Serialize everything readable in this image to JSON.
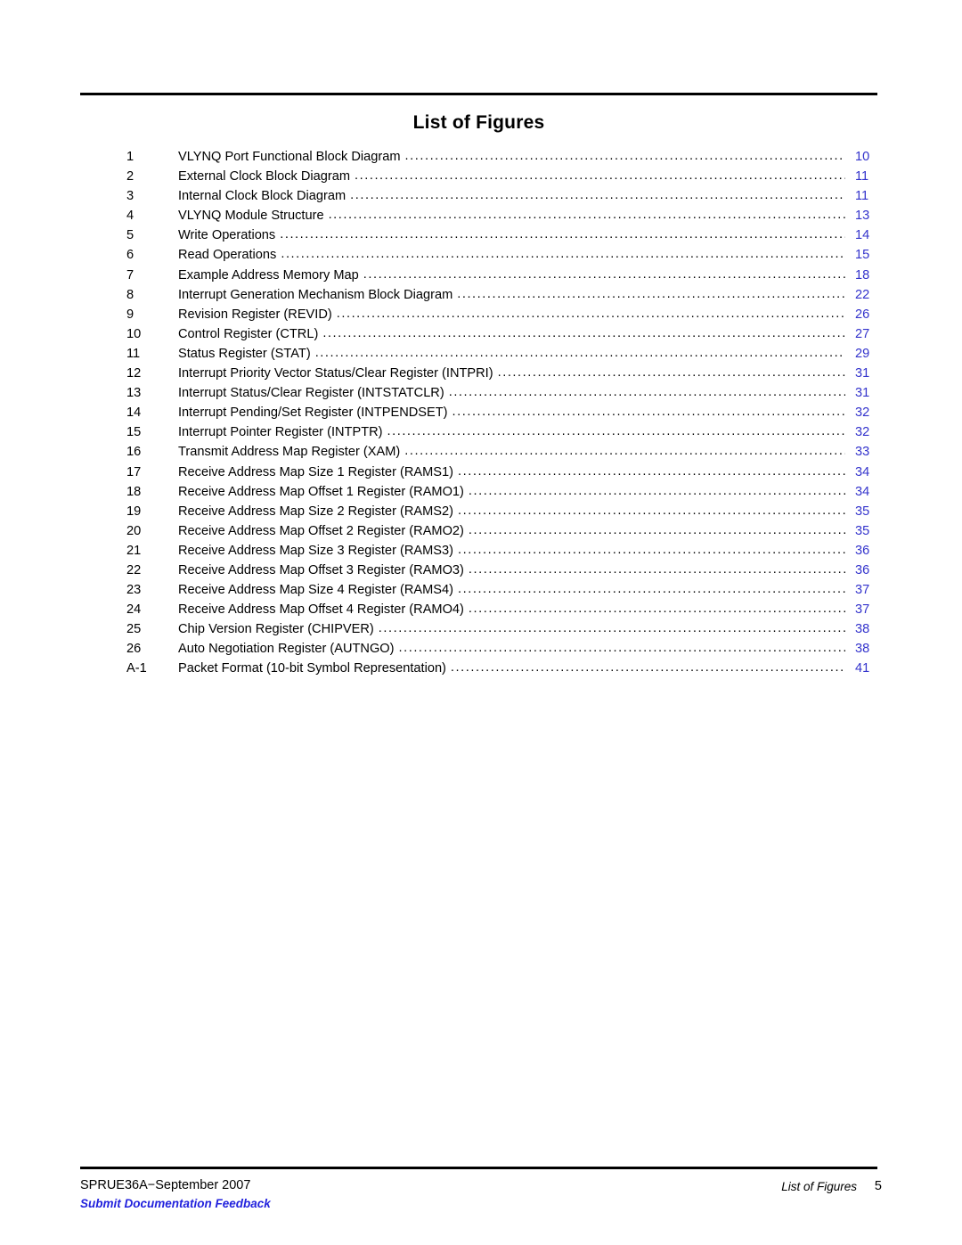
{
  "header": {
    "title": "List of Figures"
  },
  "figures": [
    {
      "number": "1",
      "title": "VLYNQ Port Functional Block Diagram",
      "page": "10"
    },
    {
      "number": "2",
      "title": "External Clock Block Diagram",
      "page": "11"
    },
    {
      "number": "3",
      "title": "Internal Clock Block Diagram",
      "page": "11"
    },
    {
      "number": "4",
      "title": "VLYNQ Module Structure",
      "page": "13"
    },
    {
      "number": "5",
      "title": "Write Operations",
      "page": "14"
    },
    {
      "number": "6",
      "title": "Read Operations",
      "page": "15"
    },
    {
      "number": "7",
      "title": "Example Address Memory Map",
      "page": "18"
    },
    {
      "number": "8",
      "title": "Interrupt Generation Mechanism Block Diagram",
      "page": "22"
    },
    {
      "number": "9",
      "title": "Revision Register (REVID)",
      "page": "26"
    },
    {
      "number": "10",
      "title": "Control Register (CTRL)",
      "page": "27"
    },
    {
      "number": "11",
      "title": "Status Register (STAT)",
      "page": "29"
    },
    {
      "number": "12",
      "title": "Interrupt Priority Vector Status/Clear Register (INTPRI)",
      "page": "31"
    },
    {
      "number": "13",
      "title": "Interrupt Status/Clear Register (INTSTATCLR)",
      "page": "31"
    },
    {
      "number": "14",
      "title": "Interrupt Pending/Set Register (INTPENDSET)",
      "page": "32"
    },
    {
      "number": "15",
      "title": "Interrupt Pointer Register (INTPTR)",
      "page": "32"
    },
    {
      "number": "16",
      "title": "Transmit Address Map Register (XAM)",
      "page": "33"
    },
    {
      "number": "17",
      "title": "Receive Address Map Size 1 Register (RAMS1)",
      "page": "34"
    },
    {
      "number": "18",
      "title": "Receive Address Map Offset 1 Register (RAMO1)",
      "page": "34"
    },
    {
      "number": "19",
      "title": "Receive Address Map Size 2 Register (RAMS2)",
      "page": "35"
    },
    {
      "number": "20",
      "title": "Receive Address Map Offset 2 Register (RAMO2)",
      "page": "35"
    },
    {
      "number": "21",
      "title": "Receive Address Map Size 3 Register (RAMS3)",
      "page": "36"
    },
    {
      "number": "22",
      "title": "Receive Address Map Offset 3 Register (RAMO3)",
      "page": "36"
    },
    {
      "number": "23",
      "title": "Receive Address Map Size 4 Register (RAMS4)",
      "page": "37"
    },
    {
      "number": "24",
      "title": "Receive Address Map Offset 4 Register (RAMO4)",
      "page": "37"
    },
    {
      "number": "25",
      "title": "Chip Version Register (CHIPVER)",
      "page": "38"
    },
    {
      "number": "26",
      "title": "Auto Negotiation Register (AUTNGO)",
      "page": "38"
    },
    {
      "number": "A-1",
      "title": "Packet Format (10-bit Symbol Representation)",
      "page": "41"
    }
  ],
  "footer": {
    "document_id": "SPRUE36A−September 2007",
    "feedback_link": "Submit Documentation Feedback",
    "section": "List of Figures",
    "page_number": "5"
  },
  "colors": {
    "page_number_link": "#3333cc",
    "feedback_link": "#2222dd",
    "text": "#000000"
  }
}
